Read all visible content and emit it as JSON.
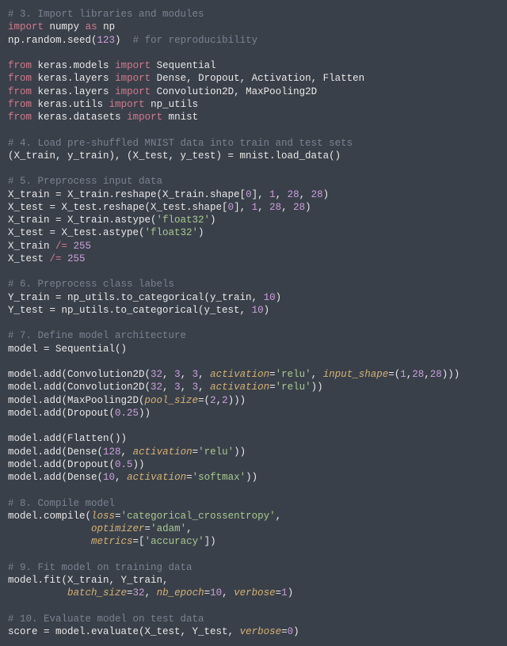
{
  "lines": [
    {
      "t": "comment",
      "text": "# 3. Import libraries and modules"
    },
    {
      "t": "code",
      "html": "<span class='k'>import</span> <span class='n'>numpy</span> <span class='k'>as</span> <span class='n'>np</span>"
    },
    {
      "t": "code",
      "html": "<span class='n'>np.random.seed(</span><span class='num'>123</span><span class='n'>)</span>  <span class='c'># for reproducibility</span>"
    },
    {
      "t": "blank",
      "text": ""
    },
    {
      "t": "code",
      "html": "<span class='k'>from</span> <span class='n'>keras.models</span> <span class='k'>import</span> <span class='n'>Sequential</span>"
    },
    {
      "t": "code",
      "html": "<span class='k'>from</span> <span class='n'>keras.layers</span> <span class='k'>import</span> <span class='n'>Dense, Dropout, Activation, Flatten</span>"
    },
    {
      "t": "code",
      "html": "<span class='k'>from</span> <span class='n'>keras.layers</span> <span class='k'>import</span> <span class='n'>Convolution2D, MaxPooling2D</span>"
    },
    {
      "t": "code",
      "html": "<span class='k'>from</span> <span class='n'>keras.utils</span> <span class='k'>import</span> <span class='n'>np_utils</span>"
    },
    {
      "t": "code",
      "html": "<span class='k'>from</span> <span class='n'>keras.datasets</span> <span class='k'>import</span> <span class='n'>mnist</span>"
    },
    {
      "t": "blank",
      "text": ""
    },
    {
      "t": "comment",
      "text": "# 4. Load pre-shuffled MNIST data into train and test sets"
    },
    {
      "t": "code",
      "html": "<span class='n'>(X_train, y_train), (X_test, y_test) = mnist.load_data()</span>"
    },
    {
      "t": "blank",
      "text": ""
    },
    {
      "t": "comment",
      "text": "# 5. Preprocess input data"
    },
    {
      "t": "code",
      "html": "<span class='n'>X_train = X_train.reshape(X_train.shape[</span><span class='num'>0</span><span class='n'>], </span><span class='num'>1</span><span class='n'>, </span><span class='num'>28</span><span class='n'>, </span><span class='num'>28</span><span class='n'>)</span>"
    },
    {
      "t": "code",
      "html": "<span class='n'>X_test = X_test.reshape(X_test.shape[</span><span class='num'>0</span><span class='n'>], </span><span class='num'>1</span><span class='n'>, </span><span class='num'>28</span><span class='n'>, </span><span class='num'>28</span><span class='n'>)</span>"
    },
    {
      "t": "code",
      "html": "<span class='n'>X_train = X_train.astype(</span><span class='s'>'float32'</span><span class='n'>)</span>"
    },
    {
      "t": "code",
      "html": "<span class='n'>X_test = X_test.astype(</span><span class='s'>'float32'</span><span class='n'>)</span>"
    },
    {
      "t": "code",
      "html": "<span class='n'>X_train </span><span class='o'>/=</span><span class='n'> </span><span class='num'>255</span>"
    },
    {
      "t": "code",
      "html": "<span class='n'>X_test </span><span class='o'>/=</span><span class='n'> </span><span class='num'>255</span>"
    },
    {
      "t": "blank",
      "text": ""
    },
    {
      "t": "comment",
      "text": "# 6. Preprocess class labels"
    },
    {
      "t": "code",
      "html": "<span class='n'>Y_train = np_utils.to_categorical(y_train, </span><span class='num'>10</span><span class='n'>)</span>"
    },
    {
      "t": "code",
      "html": "<span class='n'>Y_test = np_utils.to_categorical(y_test, </span><span class='num'>10</span><span class='n'>)</span>"
    },
    {
      "t": "blank",
      "text": ""
    },
    {
      "t": "comment",
      "text": "# 7. Define model architecture"
    },
    {
      "t": "code",
      "html": "<span class='n'>model = Sequential()</span>"
    },
    {
      "t": "blank",
      "text": ""
    },
    {
      "t": "code",
      "html": "<span class='n'>model.add(Convolution2D(</span><span class='num'>32</span><span class='n'>, </span><span class='num'>3</span><span class='n'>, </span><span class='num'>3</span><span class='n'>, </span><span class='arg'>activation</span><span class='n'>=</span><span class='s'>'relu'</span><span class='n'>, </span><span class='arg'>input_shape</span><span class='n'>=(</span><span class='num'>1</span><span class='n'>,</span><span class='num'>28</span><span class='n'>,</span><span class='num'>28</span><span class='n'>)))</span>"
    },
    {
      "t": "code",
      "html": "<span class='n'>model.add(Convolution2D(</span><span class='num'>32</span><span class='n'>, </span><span class='num'>3</span><span class='n'>, </span><span class='num'>3</span><span class='n'>, </span><span class='arg'>activation</span><span class='n'>=</span><span class='s'>'relu'</span><span class='n'>))</span>"
    },
    {
      "t": "code",
      "html": "<span class='n'>model.add(MaxPooling2D(</span><span class='arg'>pool_size</span><span class='n'>=(</span><span class='num'>2</span><span class='n'>,</span><span class='num'>2</span><span class='n'>)))</span>"
    },
    {
      "t": "code",
      "html": "<span class='n'>model.add(Dropout(</span><span class='num'>0.25</span><span class='n'>))</span>"
    },
    {
      "t": "blank",
      "text": ""
    },
    {
      "t": "code",
      "html": "<span class='n'>model.add(Flatten())</span>"
    },
    {
      "t": "code",
      "html": "<span class='n'>model.add(Dense(</span><span class='num'>128</span><span class='n'>, </span><span class='arg'>activation</span><span class='n'>=</span><span class='s'>'relu'</span><span class='n'>))</span>"
    },
    {
      "t": "code",
      "html": "<span class='n'>model.add(Dropout(</span><span class='num'>0.5</span><span class='n'>))</span>"
    },
    {
      "t": "code",
      "html": "<span class='n'>model.add(Dense(</span><span class='num'>10</span><span class='n'>, </span><span class='arg'>activation</span><span class='n'>=</span><span class='s'>'softmax'</span><span class='n'>))</span>"
    },
    {
      "t": "blank",
      "text": ""
    },
    {
      "t": "comment",
      "text": "# 8. Compile model"
    },
    {
      "t": "code",
      "html": "<span class='n'>model.compile(</span><span class='arg'>loss</span><span class='n'>=</span><span class='s'>'categorical_crossentropy'</span><span class='n'>,</span>"
    },
    {
      "t": "code",
      "html": "<span class='n'>              </span><span class='arg'>optimizer</span><span class='n'>=</span><span class='s'>'adam'</span><span class='n'>,</span>"
    },
    {
      "t": "code",
      "html": "<span class='n'>              </span><span class='arg'>metrics</span><span class='n'>=[</span><span class='s'>'accuracy'</span><span class='n'>])</span>"
    },
    {
      "t": "blank",
      "text": ""
    },
    {
      "t": "comment",
      "text": "# 9. Fit model on training data"
    },
    {
      "t": "code",
      "html": "<span class='n'>model.fit(X_train, Y_train,</span>"
    },
    {
      "t": "code",
      "html": "<span class='n'>          </span><span class='arg'>batch_size</span><span class='n'>=</span><span class='num'>32</span><span class='n'>, </span><span class='arg'>nb_epoch</span><span class='n'>=</span><span class='num'>10</span><span class='n'>, </span><span class='arg'>verbose</span><span class='n'>=</span><span class='num'>1</span><span class='n'>)</span>"
    },
    {
      "t": "blank",
      "text": ""
    },
    {
      "t": "comment",
      "text": "# 10. Evaluate model on test data"
    },
    {
      "t": "code",
      "html": "<span class='n'>score = model.evaluate(X_test, Y_test, </span><span class='arg'>verbose</span><span class='n'>=</span><span class='num'>0</span><span class='n'>)</span>"
    }
  ]
}
